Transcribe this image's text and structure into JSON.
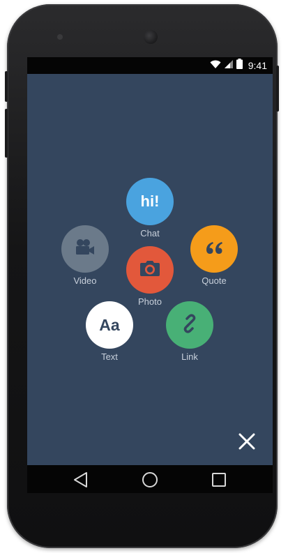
{
  "status_bar": {
    "time": "9:41",
    "icons": [
      "wifi-icon",
      "signal-icon",
      "battery-icon"
    ]
  },
  "compose_menu": {
    "items": [
      {
        "key": "chat",
        "label": "Chat",
        "glyph": "hi!",
        "color": "#4aa3df"
      },
      {
        "key": "quote",
        "label": "Quote",
        "glyph": "“",
        "color": "#f59c1a"
      },
      {
        "key": "video",
        "label": "Video",
        "icon": "video-camera-icon",
        "color": "#6b7a8a"
      },
      {
        "key": "photo",
        "label": "Photo",
        "icon": "camera-icon",
        "color": "#e2583b"
      },
      {
        "key": "text",
        "label": "Text",
        "glyph": "Aa",
        "color": "#ffffff"
      },
      {
        "key": "link",
        "label": "Link",
        "icon": "link-icon",
        "color": "#48b076"
      }
    ],
    "close_icon": "close-icon"
  },
  "nav_bar": {
    "icons": [
      "back-icon",
      "home-icon",
      "recents-icon"
    ]
  },
  "colors": {
    "screen_background": "#34465e",
    "label_text": "#c9d1dc"
  }
}
